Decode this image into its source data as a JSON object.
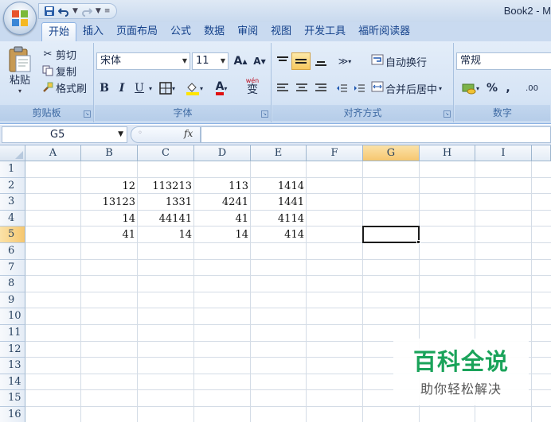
{
  "window": {
    "title": "Book2 - M"
  },
  "qat": {
    "save_icon": "save-icon",
    "undo_icon": "undo-icon",
    "redo_icon": "redo-icon",
    "customize_icon": "qat-dropdown-icon"
  },
  "tabs": [
    {
      "label": "开始",
      "active": true
    },
    {
      "label": "插入"
    },
    {
      "label": "页面布局"
    },
    {
      "label": "公式"
    },
    {
      "label": "数据"
    },
    {
      "label": "审阅"
    },
    {
      "label": "视图"
    },
    {
      "label": "开发工具"
    },
    {
      "label": "福昕阅读器"
    }
  ],
  "clipboard": {
    "paste": "粘贴",
    "cut": "剪切",
    "copy": "复制",
    "format_painter": "格式刷",
    "group_label": "剪贴板"
  },
  "font": {
    "name": "宋体",
    "size": "11",
    "grow": "A",
    "shrink": "A",
    "bold": "B",
    "italic": "I",
    "underline": "U",
    "font_color_glyph": "A",
    "phonetic": "wén",
    "phonetic_main": "变",
    "group_label": "字体"
  },
  "alignment": {
    "wrap_text": "自动换行",
    "merge_center": "合并后居中",
    "group_label": "对齐方式"
  },
  "number": {
    "format": "常规",
    "percent": "%",
    "comma": ",",
    "inc_decimal": ".00",
    "group_label": "数字"
  },
  "formula_bar": {
    "name_box": "G5",
    "fx": "fx",
    "value": ""
  },
  "columns": [
    "A",
    "B",
    "C",
    "D",
    "E",
    "F",
    "G",
    "H",
    "I"
  ],
  "rows": [
    "1",
    "2",
    "3",
    "4",
    "5",
    "6",
    "7",
    "8",
    "9",
    "10",
    "11",
    "12",
    "13",
    "14",
    "15",
    "16"
  ],
  "selected_cell": "G5",
  "cells": {
    "B2": "12",
    "C2": "113213",
    "D2": "113",
    "E2": "1414",
    "B3": "13123",
    "C3": "1331",
    "D3": "4241",
    "E3": "1441",
    "B4": "14",
    "C4": "44141",
    "D4": "41",
    "E4": "4114",
    "B5": "41",
    "C5": "14",
    "D5": "14",
    "E5": "414"
  },
  "watermark": {
    "title": "百科全说",
    "subtitle": "助你轻松解决"
  },
  "colors": {
    "ribbon": "#dfe9f5",
    "tab_text": "#15428b",
    "selection_header": "#f6c76f",
    "watermark_green": "#1aa35a"
  }
}
